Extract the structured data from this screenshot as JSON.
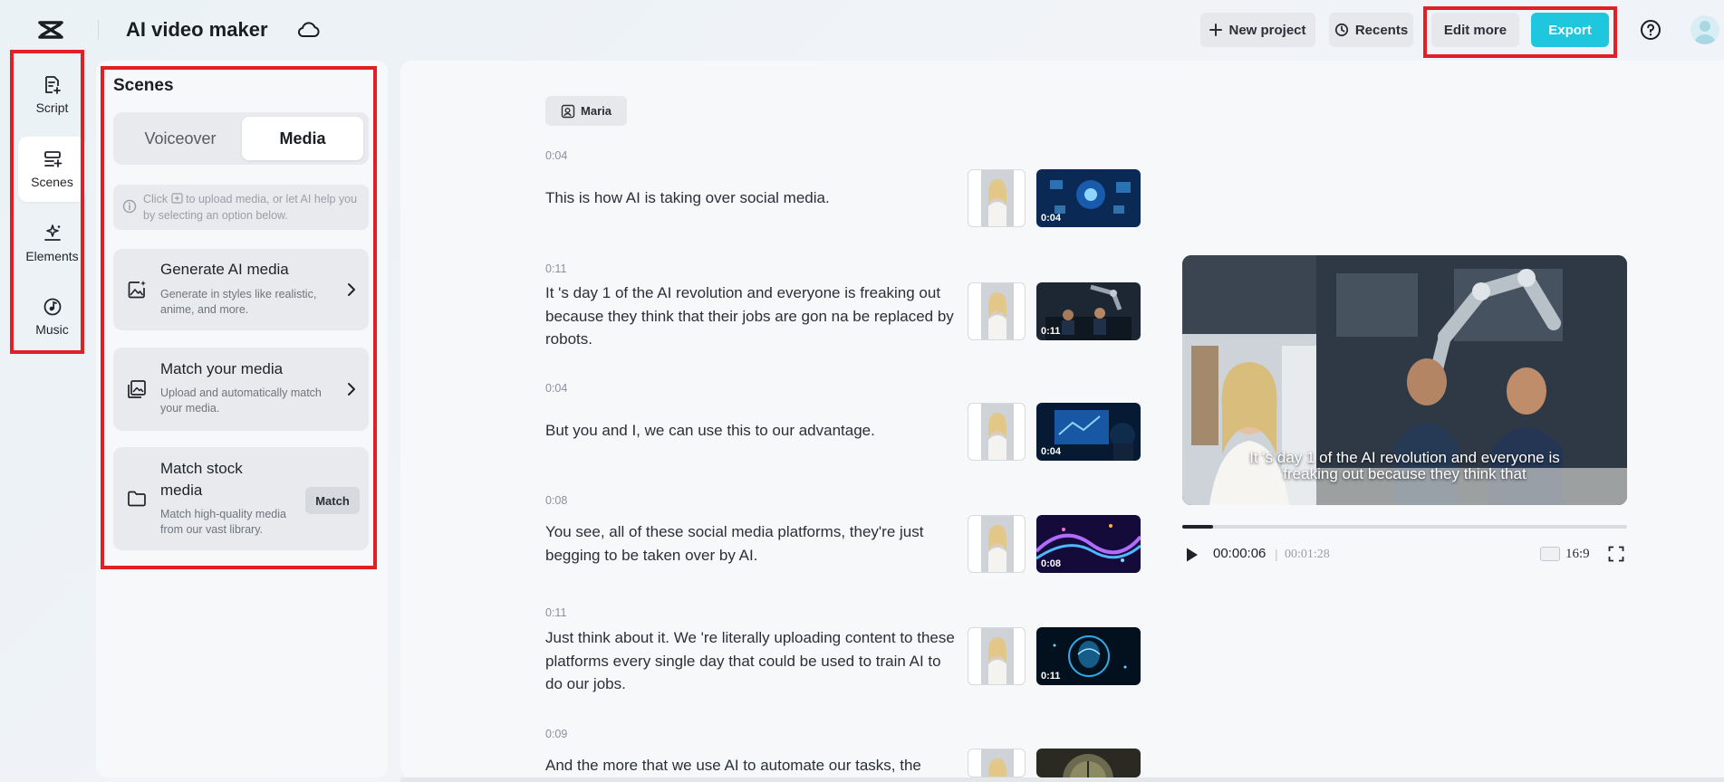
{
  "header": {
    "app_title": "AI video maker",
    "new_project_label": "New project",
    "recents_label": "Recents",
    "edit_more_label": "Edit more",
    "export_label": "Export",
    "accent_color": "#1fc7de"
  },
  "rail": {
    "items": [
      {
        "label": "Script",
        "icon": "script-icon",
        "active": false
      },
      {
        "label": "Scenes",
        "icon": "scenes-icon",
        "active": true
      },
      {
        "label": "Elements",
        "icon": "elements-icon",
        "active": false
      },
      {
        "label": "Music",
        "icon": "music-icon",
        "active": false
      }
    ]
  },
  "scenes_panel": {
    "title": "Scenes",
    "tabs": [
      {
        "label": "Voiceover",
        "selected": false
      },
      {
        "label": "Media",
        "selected": true
      }
    ],
    "info_prefix": "Click",
    "info_suffix": "to upload media, or let AI help you by selecting an option below.",
    "cards": [
      {
        "title": "Generate AI media",
        "desc": "Generate in styles like realistic, anime, and more."
      },
      {
        "title": "Match your media",
        "desc": "Upload and automatically match your media."
      },
      {
        "title": "Match stock media",
        "desc": "Match high-quality media from our vast library.",
        "button": "Match"
      }
    ]
  },
  "script": {
    "speaker": "Maria",
    "scenes": [
      {
        "time": "0:04",
        "text": "This is how AI is taking over social media.",
        "media_duration": "0:04"
      },
      {
        "time": "0:11",
        "text": "It 's day 1 of the AI revolution and everyone is freaking out because they think that their jobs are gon na be replaced by robots.",
        "media_duration": "0:11"
      },
      {
        "time": "0:04",
        "text": "But you and I, we can use this to our advantage.",
        "media_duration": "0:04"
      },
      {
        "time": "0:08",
        "text": "You see, all of these social media platforms, they're just begging to be taken over by AI.",
        "media_duration": "0:08"
      },
      {
        "time": "0:11",
        "text": "Just think about it. We 're literally uploading content to these platforms every single day that could be used to train AI to do our jobs.",
        "media_duration": "0:11"
      },
      {
        "time": "0:09",
        "text": "And the more that we use AI to automate our tasks, the",
        "media_duration": ""
      }
    ]
  },
  "player": {
    "caption_line1": "It 's day 1 of the AI revolution and everyone is",
    "caption_line2": "freaking out because they think that",
    "current_time": "00:00:06",
    "separator": "|",
    "total_time": "00:01:28",
    "progress": 0.07,
    "aspect_ratio": "16:9"
  }
}
